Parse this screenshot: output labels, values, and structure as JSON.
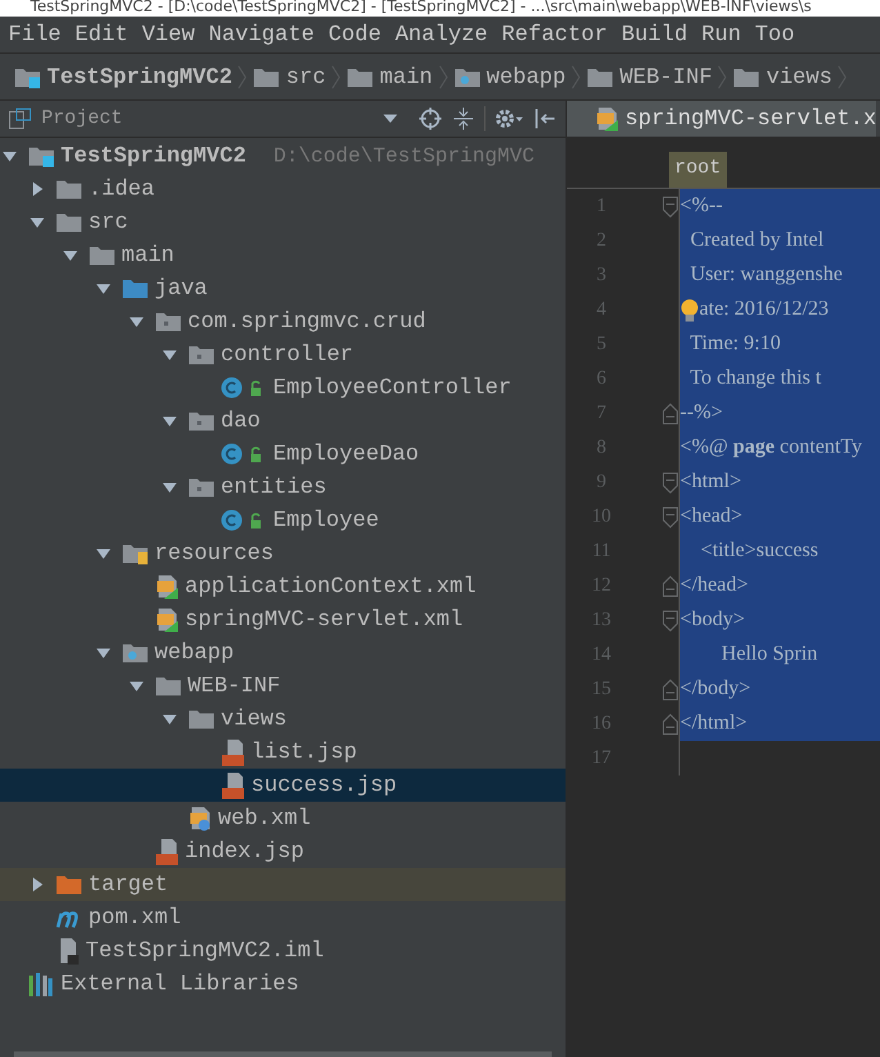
{
  "window": {
    "title": "TestSpringMVC2 - [D:\\code\\TestSpringMVC2] - [TestSpringMVC2] - ...\\src\\main\\webapp\\WEB-INF\\views\\s"
  },
  "menu": [
    "File",
    "Edit",
    "View",
    "Navigate",
    "Code",
    "Analyze",
    "Refactor",
    "Build",
    "Run",
    "Too"
  ],
  "breadcrumb": [
    {
      "label": "TestSpringMVC2",
      "kind": "module"
    },
    {
      "label": "src",
      "kind": "folder"
    },
    {
      "label": "main",
      "kind": "folder"
    },
    {
      "label": "webapp",
      "kind": "web-folder"
    },
    {
      "label": "WEB-INF",
      "kind": "folder"
    },
    {
      "label": "views",
      "kind": "folder"
    }
  ],
  "sidebar": {
    "title": "Project",
    "tree": [
      {
        "label": "TestSpringMVC2",
        "path": "D:\\code\\TestSpringMVC",
        "kind": "module",
        "expanded": true,
        "selected": false,
        "children": [
          {
            "label": ".idea",
            "kind": "folder",
            "expanded": false,
            "selected": false
          },
          {
            "label": "src",
            "kind": "folder",
            "expanded": true,
            "selected": false,
            "children": [
              {
                "label": "main",
                "kind": "folder",
                "expanded": true,
                "selected": false,
                "children": [
                  {
                    "label": "java",
                    "kind": "source-folder",
                    "expanded": true,
                    "selected": false,
                    "children": [
                      {
                        "label": "com.springmvc.crud",
                        "kind": "package",
                        "expanded": true,
                        "selected": false,
                        "children": [
                          {
                            "label": "controller",
                            "kind": "package",
                            "expanded": true,
                            "selected": false,
                            "children": [
                              {
                                "label": "EmployeeController",
                                "kind": "class",
                                "selected": false
                              }
                            ]
                          },
                          {
                            "label": "dao",
                            "kind": "package",
                            "expanded": true,
                            "selected": false,
                            "children": [
                              {
                                "label": "EmployeeDao",
                                "kind": "class",
                                "selected": false
                              }
                            ]
                          },
                          {
                            "label": "entities",
                            "kind": "package",
                            "expanded": true,
                            "selected": false,
                            "children": [
                              {
                                "label": "Employee",
                                "kind": "class",
                                "selected": false
                              }
                            ]
                          }
                        ]
                      }
                    ]
                  },
                  {
                    "label": "resources",
                    "kind": "resources-folder",
                    "expanded": true,
                    "selected": false,
                    "children": [
                      {
                        "label": "applicationContext.xml",
                        "kind": "spring-xml",
                        "selected": false
                      },
                      {
                        "label": "springMVC-servlet.xml",
                        "kind": "spring-xml",
                        "selected": false
                      }
                    ]
                  },
                  {
                    "label": "webapp",
                    "kind": "web-folder",
                    "expanded": true,
                    "selected": false,
                    "children": [
                      {
                        "label": "WEB-INF",
                        "kind": "folder",
                        "expanded": true,
                        "selected": false,
                        "children": [
                          {
                            "label": "views",
                            "kind": "folder",
                            "expanded": true,
                            "selected": false,
                            "children": [
                              {
                                "label": "list.jsp",
                                "kind": "jsp",
                                "selected": false
                              },
                              {
                                "label": "success.jsp",
                                "kind": "jsp",
                                "selected": true
                              }
                            ]
                          },
                          {
                            "label": "web.xml",
                            "kind": "web-xml",
                            "selected": false
                          }
                        ]
                      },
                      {
                        "label": "index.jsp",
                        "kind": "jsp",
                        "selected": false
                      }
                    ]
                  }
                ]
              }
            ]
          },
          {
            "label": "target",
            "kind": "excluded-folder",
            "expanded": false,
            "selected": false
          },
          {
            "label": "pom.xml",
            "kind": "maven",
            "selected": false
          },
          {
            "label": "TestSpringMVC2.iml",
            "kind": "iml",
            "selected": false
          }
        ]
      },
      {
        "label": "External Libraries",
        "kind": "libraries",
        "selected": false
      }
    ]
  },
  "editor": {
    "tab": {
      "label": "springMVC-servlet.x",
      "selected": true
    },
    "breadcrumb": "root",
    "lines": [
      {
        "number": "1",
        "text": "<%--",
        "selected": true,
        "kind": "fold-start"
      },
      {
        "number": "2",
        "text": "  Created by Intel",
        "selected": true
      },
      {
        "number": "3",
        "text": "  User: wanggenshe",
        "selected": true
      },
      {
        "number": "4",
        "text": "ate: 2016/12/23",
        "selected": true,
        "bulb": true
      },
      {
        "number": "5",
        "text": "  Time: 9:10",
        "selected": true
      },
      {
        "number": "6",
        "text": "  To change this t",
        "selected": true
      },
      {
        "number": "7",
        "text": "--%>",
        "selected": true,
        "kind": "fold-end"
      },
      {
        "number": "8",
        "text": "<%@ **page** contentTy",
        "selected": true
      },
      {
        "number": "9",
        "text": "<html>",
        "selected": true,
        "kind": "fold-start"
      },
      {
        "number": "10",
        "text": "<head>",
        "selected": true,
        "kind": "fold-start"
      },
      {
        "number": "11",
        "text": "    <title>success",
        "selected": true
      },
      {
        "number": "12",
        "text": "</head>",
        "selected": true,
        "kind": "fold-end"
      },
      {
        "number": "13",
        "text": "<body>",
        "selected": true,
        "kind": "fold-start"
      },
      {
        "number": "14",
        "text": "        Hello Sprin",
        "selected": true
      },
      {
        "number": "15",
        "text": "</body>",
        "selected": true,
        "kind": "fold-end"
      },
      {
        "number": "16",
        "text": "</html>",
        "selected": true,
        "kind": "fold-end"
      },
      {
        "number": "17",
        "selected": false
      }
    ]
  }
}
